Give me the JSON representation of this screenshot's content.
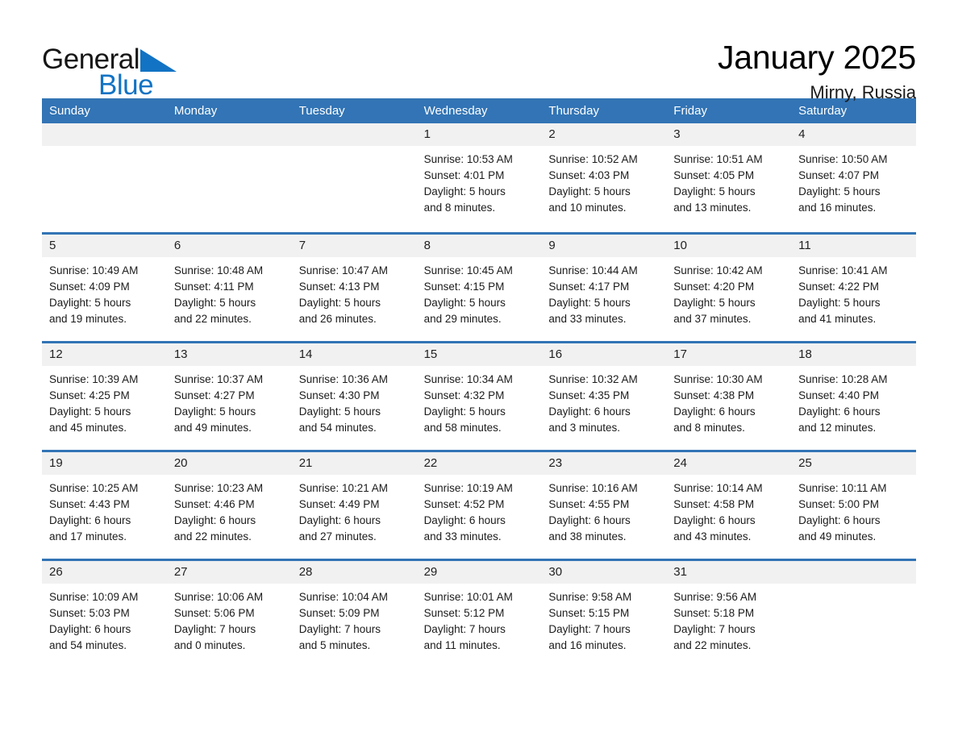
{
  "brand": {
    "word1": "General",
    "word2": "Blue",
    "triangle_color": "#1273c4",
    "text_color": "#161616",
    "blue_color": "#1273c4"
  },
  "header": {
    "title": "January 2025",
    "subtitle": "Mirny, Russia"
  },
  "theme": {
    "header_blue": "#3274b5",
    "day_band_gray": "#f1f1f1",
    "cell_white": "#ffffff",
    "text_dark": "#1b1b1b"
  },
  "weekdays": [
    "Sunday",
    "Monday",
    "Tuesday",
    "Wednesday",
    "Thursday",
    "Friday",
    "Saturday"
  ],
  "weeks": [
    [
      {
        "day": "",
        "lines": []
      },
      {
        "day": "",
        "lines": []
      },
      {
        "day": "",
        "lines": []
      },
      {
        "day": "1",
        "lines": [
          "Sunrise: 10:53 AM",
          "Sunset: 4:01 PM",
          "Daylight: 5 hours",
          "and 8 minutes."
        ]
      },
      {
        "day": "2",
        "lines": [
          "Sunrise: 10:52 AM",
          "Sunset: 4:03 PM",
          "Daylight: 5 hours",
          "and 10 minutes."
        ]
      },
      {
        "day": "3",
        "lines": [
          "Sunrise: 10:51 AM",
          "Sunset: 4:05 PM",
          "Daylight: 5 hours",
          "and 13 minutes."
        ]
      },
      {
        "day": "4",
        "lines": [
          "Sunrise: 10:50 AM",
          "Sunset: 4:07 PM",
          "Daylight: 5 hours",
          "and 16 minutes."
        ]
      }
    ],
    [
      {
        "day": "5",
        "lines": [
          "Sunrise: 10:49 AM",
          "Sunset: 4:09 PM",
          "Daylight: 5 hours",
          "and 19 minutes."
        ]
      },
      {
        "day": "6",
        "lines": [
          "Sunrise: 10:48 AM",
          "Sunset: 4:11 PM",
          "Daylight: 5 hours",
          "and 22 minutes."
        ]
      },
      {
        "day": "7",
        "lines": [
          "Sunrise: 10:47 AM",
          "Sunset: 4:13 PM",
          "Daylight: 5 hours",
          "and 26 minutes."
        ]
      },
      {
        "day": "8",
        "lines": [
          "Sunrise: 10:45 AM",
          "Sunset: 4:15 PM",
          "Daylight: 5 hours",
          "and 29 minutes."
        ]
      },
      {
        "day": "9",
        "lines": [
          "Sunrise: 10:44 AM",
          "Sunset: 4:17 PM",
          "Daylight: 5 hours",
          "and 33 minutes."
        ]
      },
      {
        "day": "10",
        "lines": [
          "Sunrise: 10:42 AM",
          "Sunset: 4:20 PM",
          "Daylight: 5 hours",
          "and 37 minutes."
        ]
      },
      {
        "day": "11",
        "lines": [
          "Sunrise: 10:41 AM",
          "Sunset: 4:22 PM",
          "Daylight: 5 hours",
          "and 41 minutes."
        ]
      }
    ],
    [
      {
        "day": "12",
        "lines": [
          "Sunrise: 10:39 AM",
          "Sunset: 4:25 PM",
          "Daylight: 5 hours",
          "and 45 minutes."
        ]
      },
      {
        "day": "13",
        "lines": [
          "Sunrise: 10:37 AM",
          "Sunset: 4:27 PM",
          "Daylight: 5 hours",
          "and 49 minutes."
        ]
      },
      {
        "day": "14",
        "lines": [
          "Sunrise: 10:36 AM",
          "Sunset: 4:30 PM",
          "Daylight: 5 hours",
          "and 54 minutes."
        ]
      },
      {
        "day": "15",
        "lines": [
          "Sunrise: 10:34 AM",
          "Sunset: 4:32 PM",
          "Daylight: 5 hours",
          "and 58 minutes."
        ]
      },
      {
        "day": "16",
        "lines": [
          "Sunrise: 10:32 AM",
          "Sunset: 4:35 PM",
          "Daylight: 6 hours",
          "and 3 minutes."
        ]
      },
      {
        "day": "17",
        "lines": [
          "Sunrise: 10:30 AM",
          "Sunset: 4:38 PM",
          "Daylight: 6 hours",
          "and 8 minutes."
        ]
      },
      {
        "day": "18",
        "lines": [
          "Sunrise: 10:28 AM",
          "Sunset: 4:40 PM",
          "Daylight: 6 hours",
          "and 12 minutes."
        ]
      }
    ],
    [
      {
        "day": "19",
        "lines": [
          "Sunrise: 10:25 AM",
          "Sunset: 4:43 PM",
          "Daylight: 6 hours",
          "and 17 minutes."
        ]
      },
      {
        "day": "20",
        "lines": [
          "Sunrise: 10:23 AM",
          "Sunset: 4:46 PM",
          "Daylight: 6 hours",
          "and 22 minutes."
        ]
      },
      {
        "day": "21",
        "lines": [
          "Sunrise: 10:21 AM",
          "Sunset: 4:49 PM",
          "Daylight: 6 hours",
          "and 27 minutes."
        ]
      },
      {
        "day": "22",
        "lines": [
          "Sunrise: 10:19 AM",
          "Sunset: 4:52 PM",
          "Daylight: 6 hours",
          "and 33 minutes."
        ]
      },
      {
        "day": "23",
        "lines": [
          "Sunrise: 10:16 AM",
          "Sunset: 4:55 PM",
          "Daylight: 6 hours",
          "and 38 minutes."
        ]
      },
      {
        "day": "24",
        "lines": [
          "Sunrise: 10:14 AM",
          "Sunset: 4:58 PM",
          "Daylight: 6 hours",
          "and 43 minutes."
        ]
      },
      {
        "day": "25",
        "lines": [
          "Sunrise: 10:11 AM",
          "Sunset: 5:00 PM",
          "Daylight: 6 hours",
          "and 49 minutes."
        ]
      }
    ],
    [
      {
        "day": "26",
        "lines": [
          "Sunrise: 10:09 AM",
          "Sunset: 5:03 PM",
          "Daylight: 6 hours",
          "and 54 minutes."
        ]
      },
      {
        "day": "27",
        "lines": [
          "Sunrise: 10:06 AM",
          "Sunset: 5:06 PM",
          "Daylight: 7 hours",
          "and 0 minutes."
        ]
      },
      {
        "day": "28",
        "lines": [
          "Sunrise: 10:04 AM",
          "Sunset: 5:09 PM",
          "Daylight: 7 hours",
          "and 5 minutes."
        ]
      },
      {
        "day": "29",
        "lines": [
          "Sunrise: 10:01 AM",
          "Sunset: 5:12 PM",
          "Daylight: 7 hours",
          "and 11 minutes."
        ]
      },
      {
        "day": "30",
        "lines": [
          "Sunrise: 9:58 AM",
          "Sunset: 5:15 PM",
          "Daylight: 7 hours",
          "and 16 minutes."
        ]
      },
      {
        "day": "31",
        "lines": [
          "Sunrise: 9:56 AM",
          "Sunset: 5:18 PM",
          "Daylight: 7 hours",
          "and 22 minutes."
        ]
      },
      {
        "day": "",
        "lines": []
      }
    ]
  ]
}
